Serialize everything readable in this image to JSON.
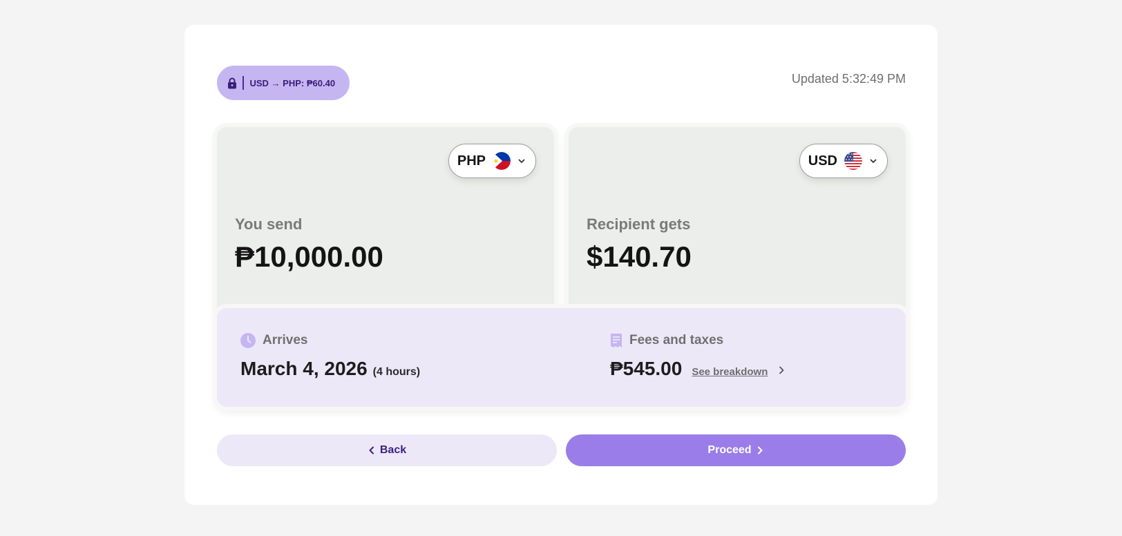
{
  "rate_badge": {
    "text": "USD → PHP: ₱60.40",
    "icon": "lock-icon"
  },
  "updated_text": "Updated 5:32:49 PM",
  "send_card": {
    "currency_code": "PHP",
    "flag_icon": "philippines-flag-icon",
    "label": "You send",
    "amount": "₱10,000.00"
  },
  "receive_card": {
    "currency_code": "USD",
    "flag_icon": "us-flag-icon",
    "label": "Recipient gets",
    "amount": "$140.70"
  },
  "arrival": {
    "title": "Arrives",
    "icon": "clock-icon",
    "date": "March 4, 2026",
    "duration": "(4 hours)"
  },
  "fees": {
    "title": "Fees and taxes",
    "icon": "receipt-icon",
    "amount": "₱545.00",
    "breakdown_link": "See breakdown"
  },
  "buttons": {
    "back": "Back",
    "proceed": "Proceed"
  },
  "colors": {
    "accent": "#9a7de8",
    "accent_light": "#ede8f8",
    "badge": "#c5b6f2",
    "card_bg": "#ebeeea"
  }
}
